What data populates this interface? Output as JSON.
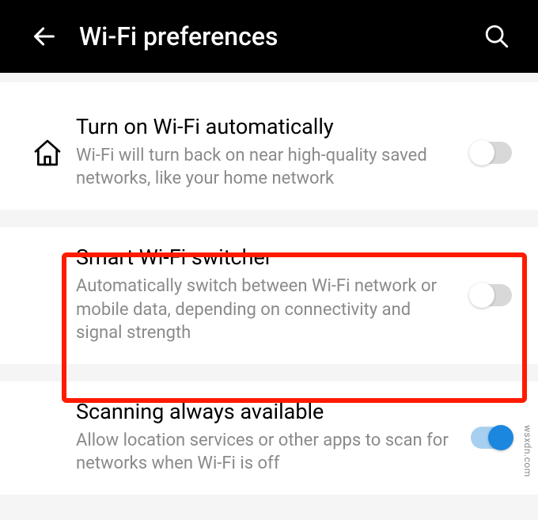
{
  "header": {
    "title": "Wi-Fi preferences"
  },
  "settings": {
    "auto_wifi": {
      "title": "Turn on Wi-Fi automatically",
      "desc": "Wi-Fi will turn back on near high-quality saved networks, like your home network",
      "enabled": false
    },
    "smart_switcher": {
      "title": "Smart Wi-Fi switcher",
      "desc": "Automatically switch between Wi-Fi network or mobile data, depending on connectivity and signal strength",
      "enabled": false
    },
    "scanning": {
      "title": "Scanning always available",
      "desc": "Allow location services or other apps to scan for networks when Wi-Fi is off",
      "enabled": true
    }
  },
  "watermark": "wsxdn.com"
}
